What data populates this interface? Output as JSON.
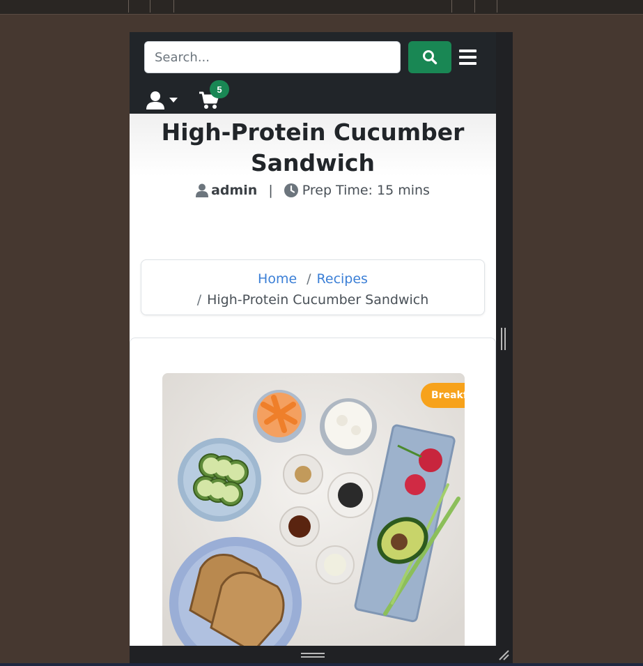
{
  "navbar": {
    "search": {
      "placeholder": "Search...",
      "value": ""
    },
    "cart_count": "5"
  },
  "recipe": {
    "title": "High-Protein Cucumber Sandwich",
    "author": "admin",
    "separator": "|",
    "prep_time": "Prep Time: 15 mins",
    "category_badge": "Breakfast"
  },
  "breadcrumb": {
    "home": "Home",
    "recipes": "Recipes",
    "current": "High-Protein Cucumber Sandwich",
    "divider": "/"
  },
  "colors": {
    "navbar_bg": "#212529",
    "search_button": "#198754",
    "cart_badge": "#198754",
    "link": "#3b7fd6",
    "category_badge": "#f7a21b"
  },
  "icons": [
    "search-icon",
    "hamburger-icon",
    "user-icon",
    "caret-down-icon",
    "cart-icon",
    "clock-icon"
  ]
}
